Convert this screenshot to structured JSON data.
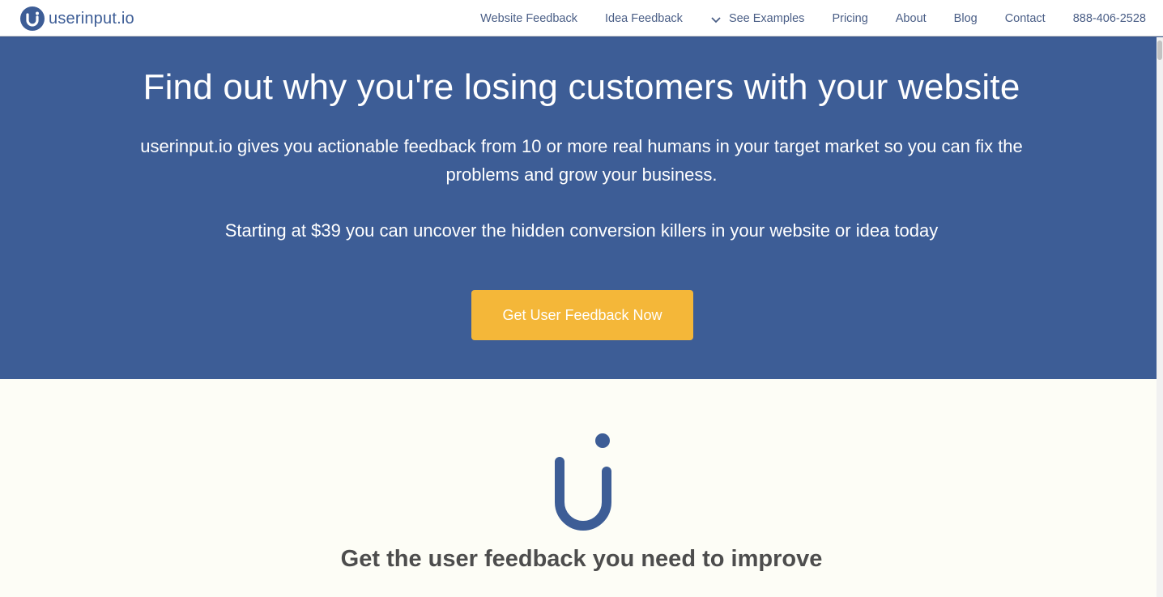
{
  "brand": {
    "name": "userinput.io",
    "color": "#3d5d96"
  },
  "nav": {
    "items": [
      {
        "label": "Website Feedback"
      },
      {
        "label": "Idea Feedback"
      },
      {
        "label": "See Examples",
        "icon": "chevron-down-icon"
      },
      {
        "label": "Pricing"
      },
      {
        "label": "About"
      },
      {
        "label": "Blog"
      },
      {
        "label": "Contact"
      }
    ],
    "phone": "888-406-2528"
  },
  "hero": {
    "title": "Find out why you're losing customers with your website",
    "subtitle": "userinput.io gives you actionable feedback from 10 or more real humans in your target market so you can fix the problems and grow your business.",
    "price_line": "Starting at $39 you can uncover the hidden conversion killers in your website or idea today",
    "cta_label": "Get User Feedback Now",
    "background": "#3d5d96",
    "cta_color": "#f4b739"
  },
  "section": {
    "title": "Get the user feedback you need to improve"
  }
}
